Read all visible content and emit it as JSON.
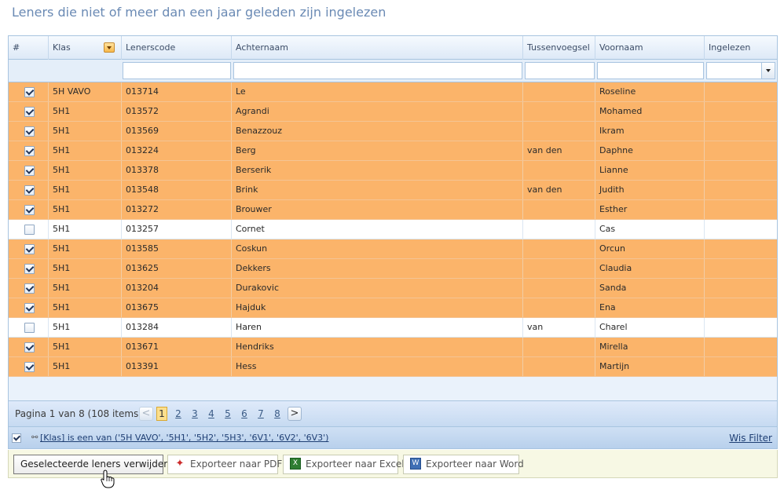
{
  "page": {
    "title": "Leners die niet of meer dan een jaar geleden zijn ingelezen"
  },
  "grid": {
    "columns": {
      "num": "#",
      "klas": "Klas",
      "lenerscode": "Lenerscode",
      "achternaam": "Achternaam",
      "tussenvoegsel": "Tussenvoegsel",
      "voornaam": "Voornaam",
      "ingelezen": "Ingelezen"
    },
    "filters": {
      "lenerscode": "",
      "achternaam": "",
      "tussenvoegsel": "",
      "voornaam": "",
      "ingelezen": ""
    },
    "rows": [
      {
        "checked": true,
        "klas": "5H VAVO",
        "code": "013714",
        "achternaam": "Le",
        "tussenvoegsel": "",
        "voornaam": "Roseline",
        "ingelezen": ""
      },
      {
        "checked": true,
        "klas": "5H1",
        "code": "013572",
        "achternaam": "Agrandi",
        "tussenvoegsel": "",
        "voornaam": "Mohamed",
        "ingelezen": ""
      },
      {
        "checked": true,
        "klas": "5H1",
        "code": "013569",
        "achternaam": "Benazzouz",
        "tussenvoegsel": "",
        "voornaam": "Ikram",
        "ingelezen": ""
      },
      {
        "checked": true,
        "klas": "5H1",
        "code": "013224",
        "achternaam": "Berg",
        "tussenvoegsel": "van den",
        "voornaam": "Daphne",
        "ingelezen": ""
      },
      {
        "checked": true,
        "klas": "5H1",
        "code": "013378",
        "achternaam": "Berserik",
        "tussenvoegsel": "",
        "voornaam": "Lianne",
        "ingelezen": ""
      },
      {
        "checked": true,
        "klas": "5H1",
        "code": "013548",
        "achternaam": "Brink",
        "tussenvoegsel": "van den",
        "voornaam": "Judith",
        "ingelezen": ""
      },
      {
        "checked": true,
        "klas": "5H1",
        "code": "013272",
        "achternaam": "Brouwer",
        "tussenvoegsel": "",
        "voornaam": "Esther",
        "ingelezen": ""
      },
      {
        "checked": false,
        "klas": "5H1",
        "code": "013257",
        "achternaam": "Cornet",
        "tussenvoegsel": "",
        "voornaam": "Cas",
        "ingelezen": ""
      },
      {
        "checked": true,
        "klas": "5H1",
        "code": "013585",
        "achternaam": "Coskun",
        "tussenvoegsel": "",
        "voornaam": "Orcun",
        "ingelezen": ""
      },
      {
        "checked": true,
        "klas": "5H1",
        "code": "013625",
        "achternaam": "Dekkers",
        "tussenvoegsel": "",
        "voornaam": "Claudia",
        "ingelezen": ""
      },
      {
        "checked": true,
        "klas": "5H1",
        "code": "013204",
        "achternaam": "Durakovic",
        "tussenvoegsel": "",
        "voornaam": "Sanda",
        "ingelezen": ""
      },
      {
        "checked": true,
        "klas": "5H1",
        "code": "013675",
        "achternaam": "Hajduk",
        "tussenvoegsel": "",
        "voornaam": "Ena",
        "ingelezen": ""
      },
      {
        "checked": false,
        "klas": "5H1",
        "code": "013284",
        "achternaam": "Haren",
        "tussenvoegsel": "van",
        "voornaam": "Charel",
        "ingelezen": ""
      },
      {
        "checked": true,
        "klas": "5H1",
        "code": "013671",
        "achternaam": "Hendriks",
        "tussenvoegsel": "",
        "voornaam": "Mirella",
        "ingelezen": ""
      },
      {
        "checked": true,
        "klas": "5H1",
        "code": "013391",
        "achternaam": "Hess",
        "tussenvoegsel": "",
        "voornaam": "Martijn",
        "ingelezen": ""
      }
    ],
    "colors": {
      "selected_row": "#fbb46a",
      "unselected_row": "#ffffff",
      "header_text": "#3b4c66",
      "title_text": "#6a8ab4"
    }
  },
  "pager": {
    "summary": "Pagina 1 van 8 (108 items)",
    "prev": "<",
    "next": ">",
    "pages": [
      "1",
      "2",
      "3",
      "4",
      "5",
      "6",
      "7",
      "8"
    ],
    "current_page": "1"
  },
  "filter_bar": {
    "expression": "[Klas] is een van ('5H VAVO', '5H1', '5H2', '5H3', '6V1', '6V2', '6V3')",
    "clear_label": "Wis Filter",
    "active": true
  },
  "toolbar": {
    "delete_label": "Geselecteerde leners verwijderen",
    "export_pdf_label": "Exporteer naar PDF",
    "export_excel_label": "Exporteer naar Excel",
    "export_word_label": "Exporteer naar Word",
    "icons": [
      "pdf-icon",
      "excel-icon",
      "word-icon",
      "hand-cursor-icon"
    ]
  }
}
